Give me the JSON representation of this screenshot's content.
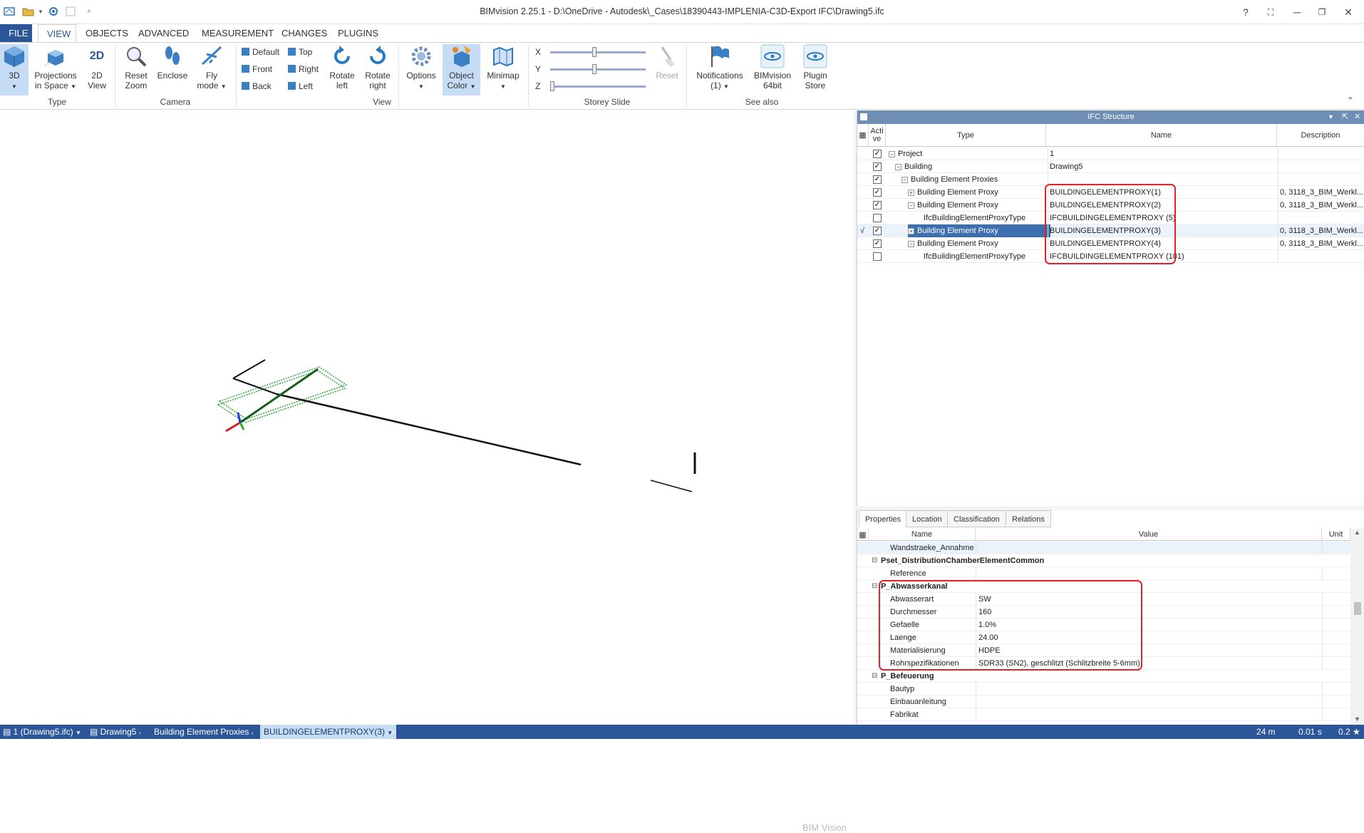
{
  "window": {
    "title": "BIMvision 2.25.1 - D:\\OneDrive - Autodesk\\_Cases\\18390443-IMPLENIA-C3D-Export IFC\\Drawing5.ifc"
  },
  "ribbon_tabs": [
    "FILE",
    "VIEW",
    "OBJECTS",
    "ADVANCED",
    "MEASUREMENT",
    "CHANGES",
    "PLUGINS"
  ],
  "ribbon": {
    "type": {
      "label": "Type",
      "btn3d": "3D",
      "proj1": "Projections",
      "proj2": "in Space",
      "view2d_1": "2D",
      "view2d_2": "View"
    },
    "camera": {
      "label": "Camera",
      "reset1": "Reset",
      "reset2": "Zoom",
      "enclose": "Enclose",
      "fly1": "Fly",
      "fly2": "mode"
    },
    "view": {
      "label": "View",
      "default": "Default",
      "top": "Top",
      "front": "Front",
      "right": "Right",
      "back": "Back",
      "left": "Left",
      "rotl1": "Rotate",
      "rotl2": "left",
      "rotr1": "Rotate",
      "rotr2": "right",
      "options": "Options",
      "oc1": "Object",
      "oc2": "Color",
      "minimap": "Minimap"
    },
    "storey": {
      "label": "Storey Slide",
      "x": "X",
      "y": "Y",
      "z": "Z",
      "reset": "Reset",
      "x_value": 0.46,
      "y_value": 0.46,
      "z_value": 0.0
    },
    "seealso": {
      "label": "See also",
      "notif1": "Notifications",
      "notif2": "(1)",
      "bv1": "BIMvision",
      "bv2": "64bit",
      "ps1": "Plugin",
      "ps2": "Store"
    }
  },
  "viewport": {
    "watermark": "BIM Vision"
  },
  "ifc": {
    "panel_title": "IFC Structure",
    "columns": {
      "active": "Acti ve",
      "type": "Type",
      "name": "Name",
      "description": "Description"
    },
    "rows": [
      {
        "check": "✓",
        "type": "Project",
        "name": "1",
        "description": ""
      },
      {
        "check": "✓",
        "type": "Building",
        "name": "Drawing5",
        "description": ""
      },
      {
        "check": "✓",
        "type": "Building Element Proxies",
        "name": "",
        "description": ""
      },
      {
        "check": "✓",
        "type": "Building Element Proxy",
        "name": "BUILDINGELEMENTPROXY(1)",
        "description": "0, 3118_3_BIM_Werkl..."
      },
      {
        "check": "✓",
        "type": "Building Element Proxy",
        "name": "BUILDINGELEMENTPROXY(2)",
        "description": "0, 3118_3_BIM_Werkl..."
      },
      {
        "check": "",
        "type": "IfcBuildingElementProxyType",
        "name": "IFCBUILDINGELEMENTPROXY (5)",
        "description": ""
      },
      {
        "check": "✓",
        "type": "Building Element Proxy",
        "name": "BUILDINGELEMENTPROXY(3)",
        "description": "0, 3118_3_BIM_Werkl...",
        "mark": "√"
      },
      {
        "check": "✓",
        "type": "Building Element Proxy",
        "name": "BUILDINGELEMENTPROXY(4)",
        "description": "0, 3118_3_BIM_Werkl..."
      },
      {
        "check": "",
        "type": "IfcBuildingElementProxyType",
        "name": "IFCBUILDINGELEMENTPROXY (101)",
        "description": ""
      }
    ]
  },
  "props": {
    "tabs": [
      "Properties",
      "Location",
      "Classification",
      "Relations"
    ],
    "columns": {
      "name": "Name",
      "value": "Value",
      "unit": "Unit"
    },
    "rows": [
      {
        "name": "Wandstraeke_Annahme",
        "value": "",
        "group": false
      },
      {
        "name": "Pset_DistributionChamberElementCommon",
        "value": "",
        "group": true
      },
      {
        "name": "Reference",
        "value": "",
        "group": false
      },
      {
        "name": "P_Abwasserkanal",
        "value": "",
        "group": true
      },
      {
        "name": "Abwasserart",
        "value": "SW",
        "group": false
      },
      {
        "name": "Durchmesser",
        "value": "160",
        "group": false
      },
      {
        "name": "Gefaelle",
        "value": "1.0%",
        "group": false
      },
      {
        "name": "Laenge",
        "value": "24.00",
        "group": false
      },
      {
        "name": "Materialisierung",
        "value": "HDPE",
        "group": false
      },
      {
        "name": "Rohrspezifikationen",
        "value": "SDR33 (SN2), geschlitzt (Schlitzbreite 5-6mm)",
        "group": false
      },
      {
        "name": "P_Befeuerung",
        "value": "",
        "group": true
      },
      {
        "name": "Bautyp",
        "value": "",
        "group": false
      },
      {
        "name": "Einbauanleitung",
        "value": "",
        "group": false
      },
      {
        "name": "Fabrikat",
        "value": "",
        "group": false
      }
    ]
  },
  "status": {
    "file": "1 (Drawing5.ifc)",
    "crumb1": "Drawing5",
    "crumb2": "Building Element Proxies",
    "crumb3": "BUILDINGELEMENTPROXY(3)",
    "more": ">",
    "dist": "24 m",
    "time": "0.01 s",
    "ver": "0.2 ★"
  },
  "colors": {
    "accent": "#2b579a",
    "highlight": "#e0242a",
    "selection": "#c5dcf4"
  }
}
